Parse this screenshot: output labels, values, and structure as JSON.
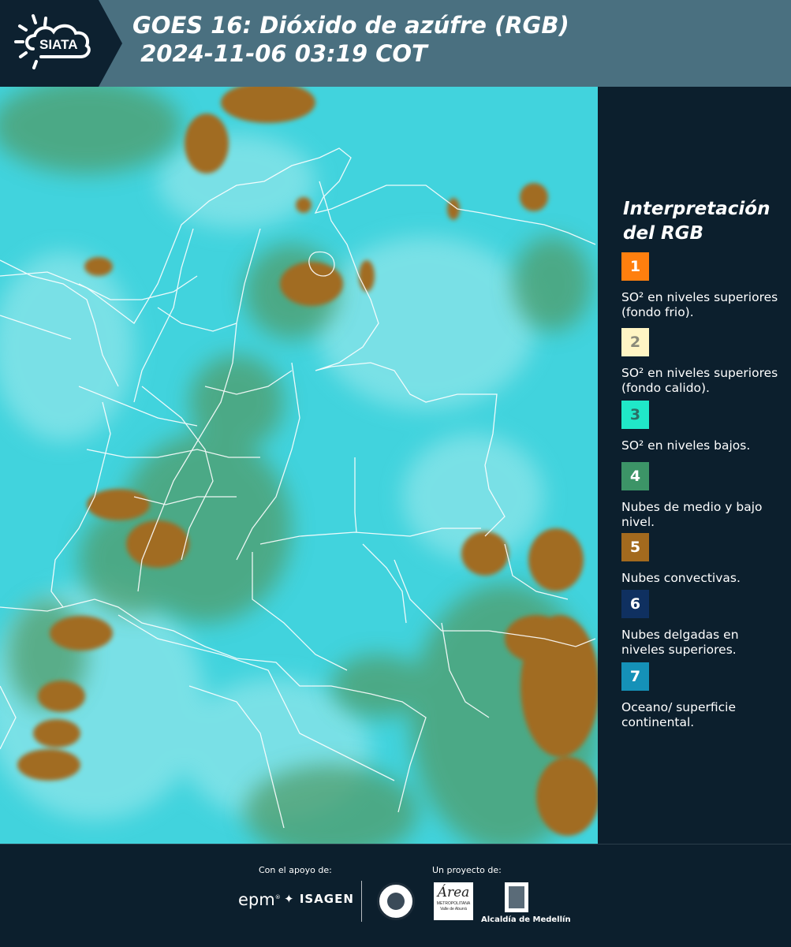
{
  "header": {
    "logo_text": "SIATA",
    "title_line1": "GOES 16: Dióxido de azúfre (RGB)",
    "title_line2": " 2024-11-06 03:19 COT"
  },
  "legend": {
    "title_line1": "Interpretación",
    "title_line2": "del RGB",
    "items": [
      {
        "num": "1",
        "color": "#ff7f0e",
        "text": "SO² en niveles superiores (fondo frio)."
      },
      {
        "num": "2",
        "color": "#fff5c4",
        "text": "SO² en niveles superiores (fondo calido)."
      },
      {
        "num": "3",
        "color": "#20e8c8",
        "text": "SO² en niveles bajos."
      },
      {
        "num": "4",
        "color": "#3c9467",
        "text": "Nubes de medio y bajo nivel."
      },
      {
        "num": "5",
        "color": "#a36a1e",
        "text": "Nubes convectivas."
      },
      {
        "num": "6",
        "color": "#0f3060",
        "text": "Nubes delgadas en niveles superiores."
      },
      {
        "num": "7",
        "color": "#1591b8",
        "text": "Oceano/ superficie continental."
      }
    ]
  },
  "footer": {
    "support_label": "Con el apoyo de:",
    "project_label": "Un proyecto de:",
    "epm": "epm",
    "isagen": "ISAGEN",
    "area_text": "Área",
    "area_sub1": "METROPOLITANA",
    "area_sub2": "Valle de Aburrá",
    "alcaldia": "Alcaldía de Medellín"
  }
}
